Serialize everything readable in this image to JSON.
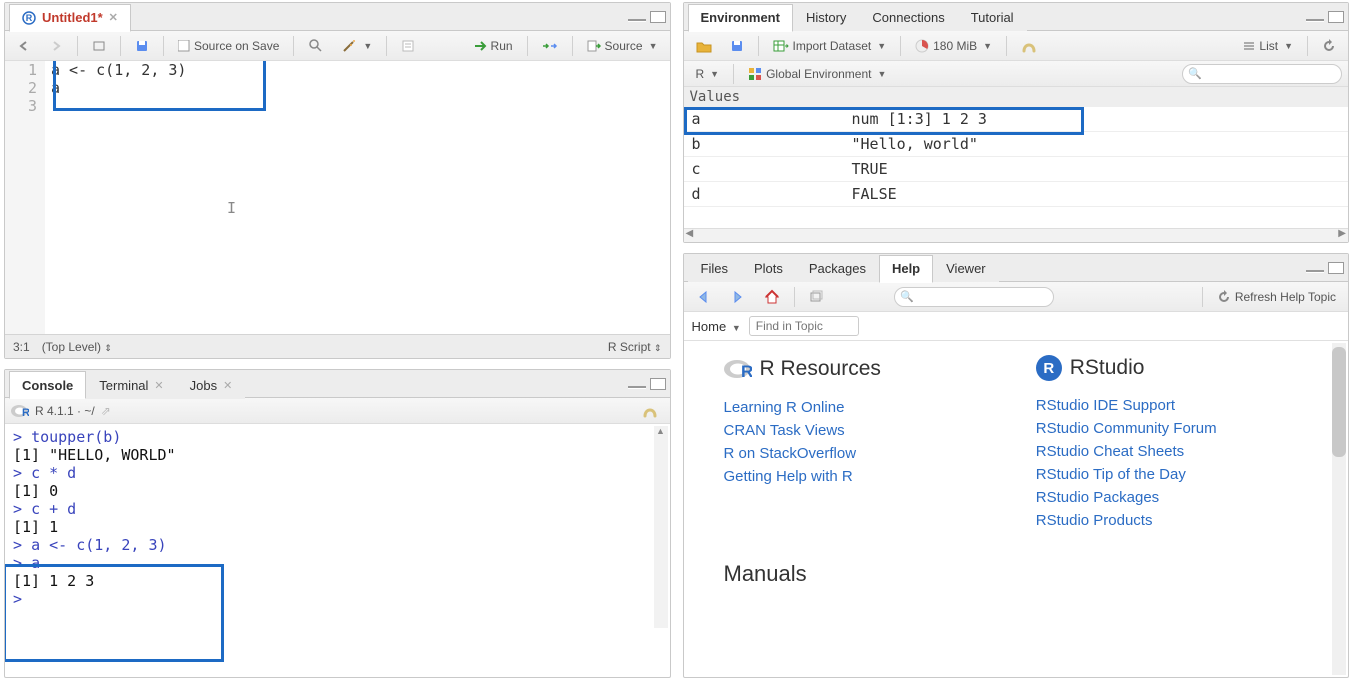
{
  "source": {
    "tab_title": "Untitled1*",
    "toolbar": {
      "source_on_save": "Source on Save",
      "run": "Run",
      "source_btn": "Source"
    },
    "lines": [
      "a <- c(1, 2, 3)",
      "a",
      ""
    ],
    "status_pos": "3:1",
    "status_scope": "(Top Level)",
    "status_lang": "R Script"
  },
  "console": {
    "tabs": [
      "Console",
      "Terminal",
      "Jobs"
    ],
    "header": "R 4.1.1 · ~/",
    "lines": [
      {
        "p": true,
        "t": "toupper(b)"
      },
      {
        "p": false,
        "t": "[1] \"HELLO, WORLD\""
      },
      {
        "p": true,
        "t": "c * d"
      },
      {
        "p": false,
        "t": "[1] 0"
      },
      {
        "p": true,
        "t": "c + d"
      },
      {
        "p": false,
        "t": "[1] 1"
      },
      {
        "p": true,
        "t": "a <- c(1, 2, 3)"
      },
      {
        "p": true,
        "t": "a"
      },
      {
        "p": false,
        "t": "[1] 1 2 3"
      },
      {
        "p": true,
        "t": ""
      }
    ]
  },
  "env": {
    "tabs": [
      "Environment",
      "History",
      "Connections",
      "Tutorial"
    ],
    "import": "Import Dataset",
    "mem": "180 MiB",
    "view": "List",
    "scope_lang": "R",
    "scope_env": "Global Environment",
    "section": "Values",
    "rows": [
      {
        "name": "a",
        "value": "num [1:3] 1 2 3"
      },
      {
        "name": "b",
        "value": "\"Hello, world\""
      },
      {
        "name": "c",
        "value": "TRUE"
      },
      {
        "name": "d",
        "value": "FALSE"
      }
    ]
  },
  "help": {
    "tabs": [
      "Files",
      "Plots",
      "Packages",
      "Help",
      "Viewer"
    ],
    "refresh": "Refresh Help Topic",
    "home": "Home",
    "find_placeholder": "Find in Topic",
    "col1_title": "R Resources",
    "col2_title": "RStudio",
    "col1_links": [
      "Learning R Online",
      "CRAN Task Views",
      "R on StackOverflow",
      "Getting Help with R"
    ],
    "col2_links": [
      "RStudio IDE Support",
      "RStudio Community Forum",
      "RStudio Cheat Sheets",
      "RStudio Tip of the Day",
      "RStudio Packages",
      "RStudio Products"
    ],
    "manuals": "Manuals"
  }
}
